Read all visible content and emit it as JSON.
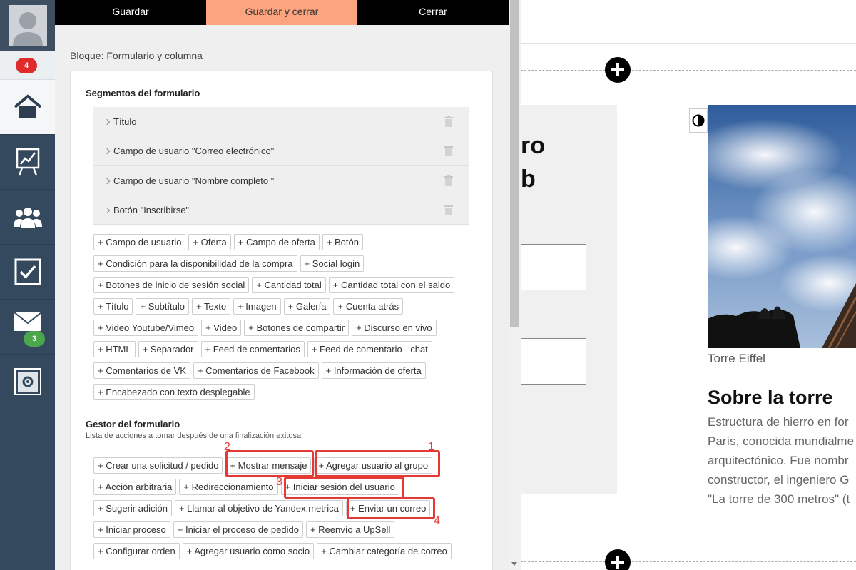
{
  "sidebar": {
    "notifications_badge": "4",
    "mail_badge": "3",
    "items": [
      {
        "name": "home-icon"
      },
      {
        "name": "chart-icon"
      },
      {
        "name": "users-icon"
      },
      {
        "name": "checkbox-icon"
      },
      {
        "name": "mail-icon"
      },
      {
        "name": "settings-icon"
      }
    ]
  },
  "toolbar": {
    "save": "Guardar",
    "save_close": "Guardar y cerrar",
    "close": "Cerrar"
  },
  "panel": {
    "block_title": "Bloque: Formulario y columna",
    "segments_title": "Segmentos del formulario",
    "segments": [
      "Título",
      "Campo de usuario \"Correo electrónico\"",
      "Campo de usuario \"Nombre completo \"",
      "Botón \"Inscribirse\""
    ],
    "add_chips": [
      [
        "+ Campo de usuario",
        "+ Oferta",
        "+ Campo de oferta",
        "+ Botón"
      ],
      [
        "+ Condición para la disponibilidad de la compra",
        "+ Social login"
      ],
      [
        "+ Botones de inicio de sesión social",
        "+ Cantidad total",
        "+ Cantidad total con el saldo"
      ],
      [
        "+ Título",
        "+ Subtítulo",
        "+ Texto",
        "+ Imagen",
        "+ Galería",
        "+ Cuenta atrás"
      ],
      [
        "+ Video Youtube/Vimeo",
        "+ Video",
        "+ Botones de compartir",
        "+ Discurso en vivo"
      ],
      [
        "+ HTML",
        "+ Separador",
        "+ Feed de comentarios",
        "+ Feed de comentario - chat"
      ],
      [
        "+ Comentarios de VK",
        "+ Comentarios de Facebook",
        "+ Información de oferta"
      ],
      [
        "+ Encabezado con texto desplegable"
      ]
    ],
    "manager_title": "Gestor del formulario",
    "manager_subtitle": "Lista de acciones a tomar después de una finalización exitosa",
    "action_chips": [
      [
        "+ Crear una solicitud / pedido",
        "+ Mostrar mensaje",
        "+ Agregar usuario al grupo"
      ],
      [
        "+ Acción arbitraria",
        "+ Redireccionamiento",
        "+ Iniciar sesión del usuario"
      ],
      [
        "+ Sugerir adición",
        "+ Llamar al objetivo de Yandex.metrica",
        "+ Enviar un correo"
      ],
      [
        "+ Iniciar proceso",
        "+ Iniciar el proceso de pedido",
        "+ Reenvío a UpSell"
      ],
      [
        "+ Configurar orden",
        "+ Agregar usuario como socio",
        "+ Cambiar categoría de correo"
      ]
    ],
    "markers": [
      "1",
      "2",
      "3",
      "4"
    ]
  },
  "preview": {
    "heading_fragment_1": "ro",
    "heading_fragment_2": "b",
    "caption": "Torre Eiffel",
    "about_title": "Sobre la torre",
    "body_lines": [
      "Estructura de hierro en for",
      "París, conocida mundialme",
      "arquitectónico. Fue nombr",
      "constructor, el ingeniero G",
      "\"La torre de 300 metros\" (t"
    ]
  },
  "colors": {
    "sidebar": "#34495e",
    "accent_button": "#fca37f",
    "highlight": "#e53935",
    "badge_red": "#e02b2b",
    "badge_green": "#4ca64c"
  }
}
